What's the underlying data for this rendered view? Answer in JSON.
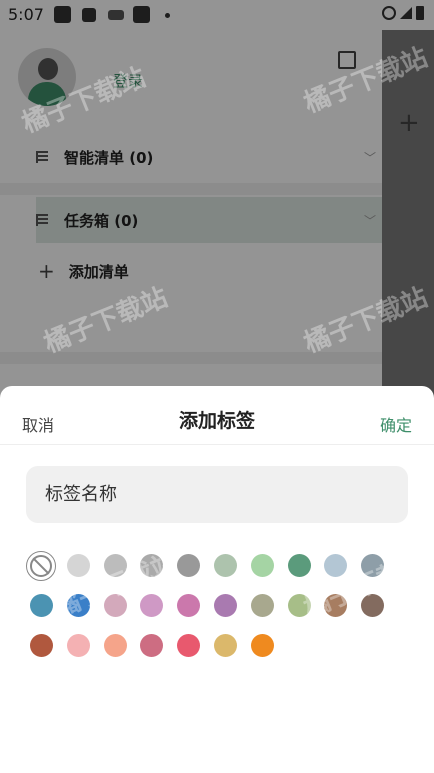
{
  "status_bar": {
    "time": "5:07"
  },
  "drawer": {
    "login_label": "登录",
    "items": [
      {
        "label": "智能清单 (0)"
      },
      {
        "label": "任务箱 (0)"
      },
      {
        "label": "添加清单"
      }
    ]
  },
  "watermark_text": "橘子下载站",
  "sheet": {
    "cancel_label": "取消",
    "title": "添加标签",
    "confirm_label": "确定",
    "name_placeholder": "标签名称",
    "colors": [
      [
        "#d5d5d5",
        "#bcbcbc",
        "#aaaaaa",
        "#999999",
        "#adc3ad",
        "#a5d4a4",
        "#5b9b7c",
        "#b3c6d4",
        "#8e9ea8"
      ],
      [
        "#4b93b2",
        "#3a7fc8",
        "#d3a9bb",
        "#cf99c5",
        "#cb78ac",
        "#a97ab0",
        "#a8a88e",
        "#a7be88",
        "#a77d61",
        "#836b5f"
      ],
      [
        "#b0583e",
        "#f4b1b3",
        "#f5a48a",
        "#cd6d82",
        "#e8596e",
        "#dbb86b",
        "#ef8a1f"
      ]
    ],
    "accent": "#3e8e6a"
  }
}
